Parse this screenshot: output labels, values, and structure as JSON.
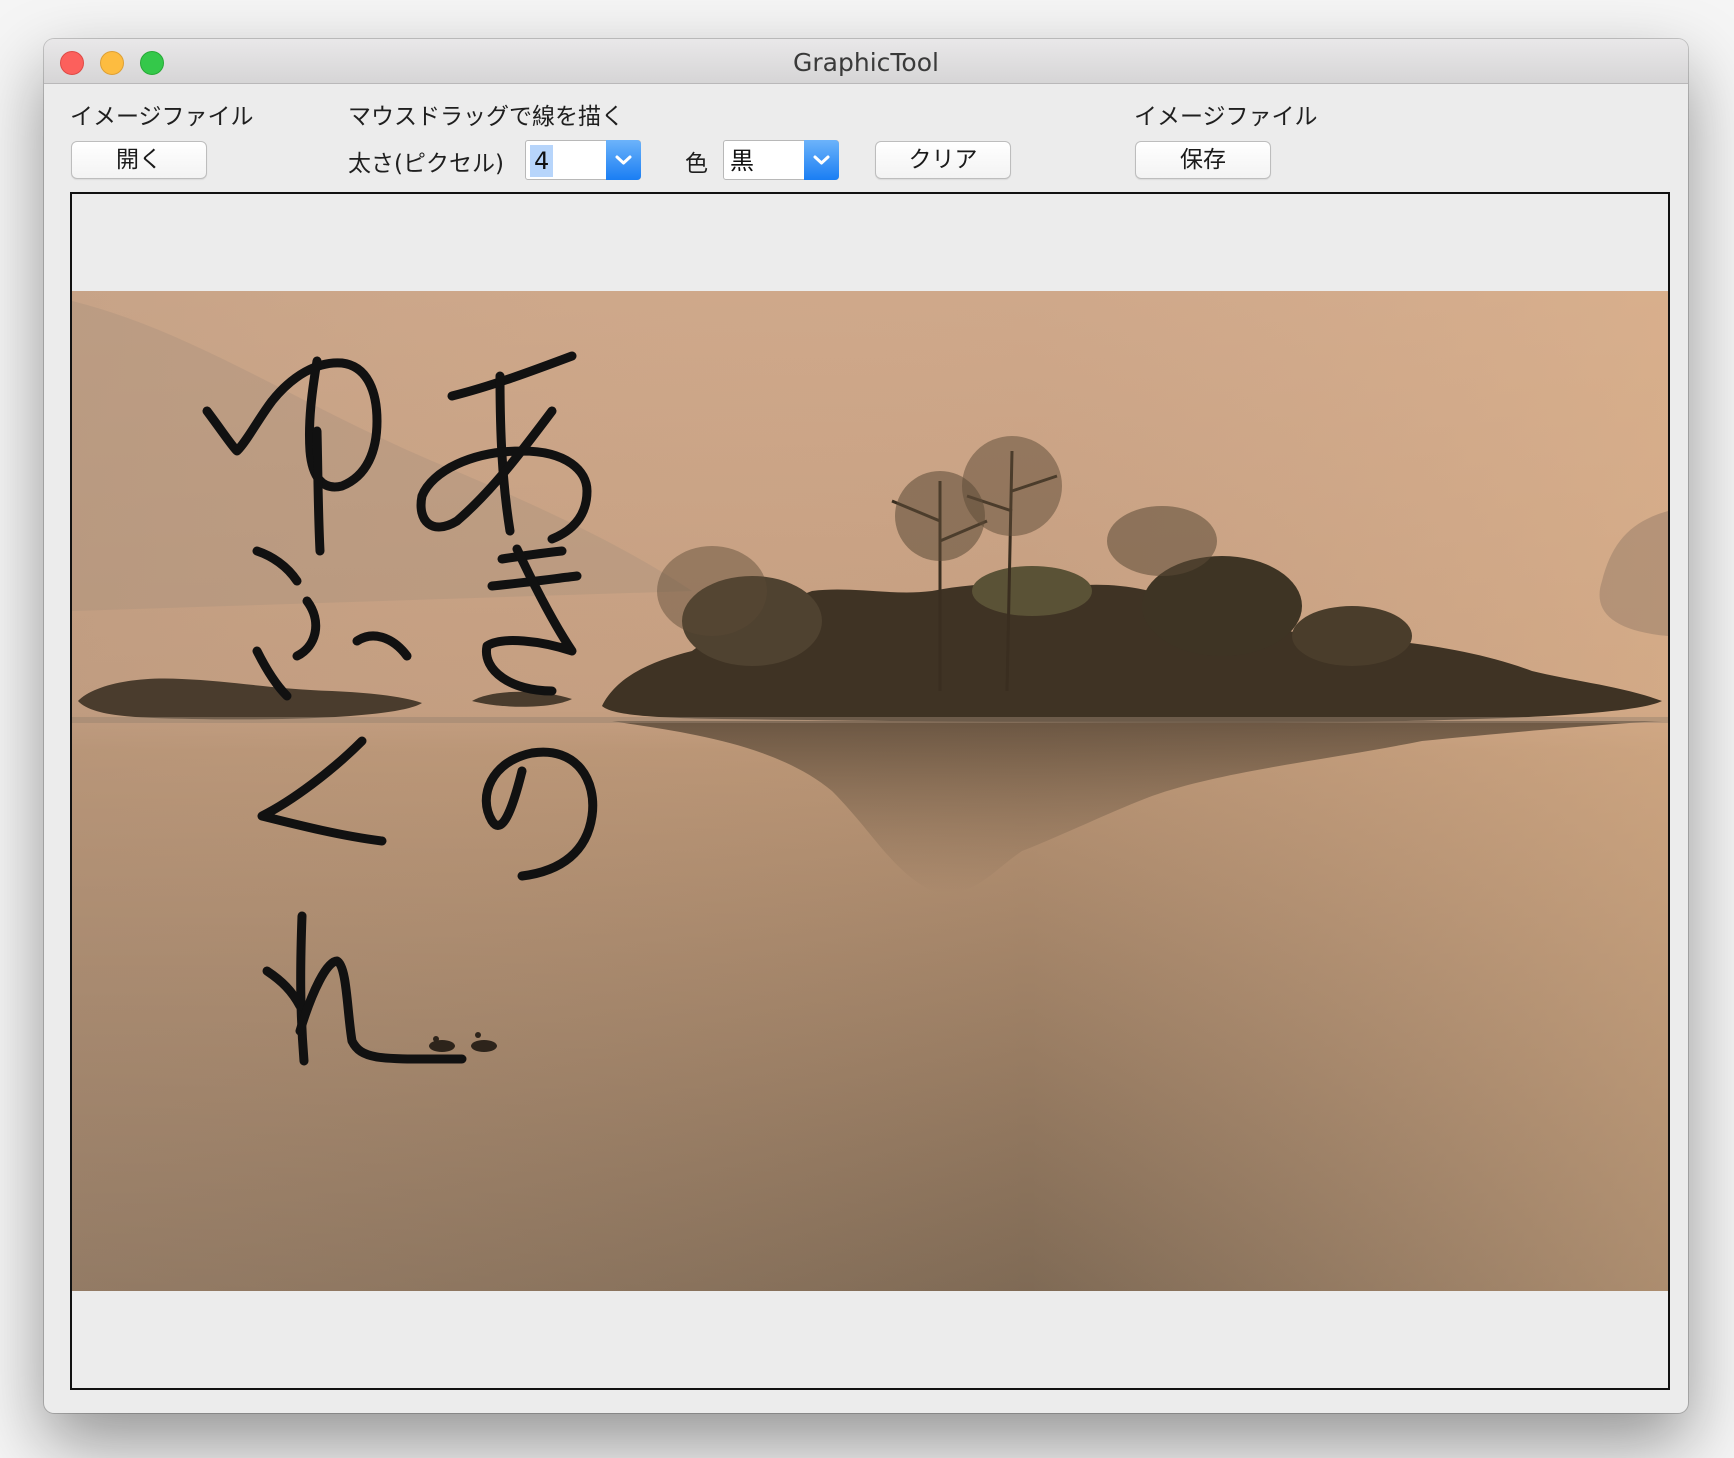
{
  "window": {
    "title": "GraphicTool"
  },
  "toolbar": {
    "open_group_label": "イメージファイル",
    "open_button": "開く",
    "draw_group_label": "マウスドラッグで線を描く",
    "thickness_label": "太さ(ピクセル)",
    "thickness_value": "4",
    "color_label": "色",
    "color_value": "黒",
    "clear_button": "クリア",
    "save_group_label": "イメージファイル",
    "save_button": "保存"
  },
  "canvas": {
    "drawn_text": "あきの ゆふくれ",
    "stroke_color": "#111111",
    "photo_palette": [
      "#d7ad89",
      "#b38d6c",
      "#8a7259",
      "#4a3a28"
    ]
  }
}
